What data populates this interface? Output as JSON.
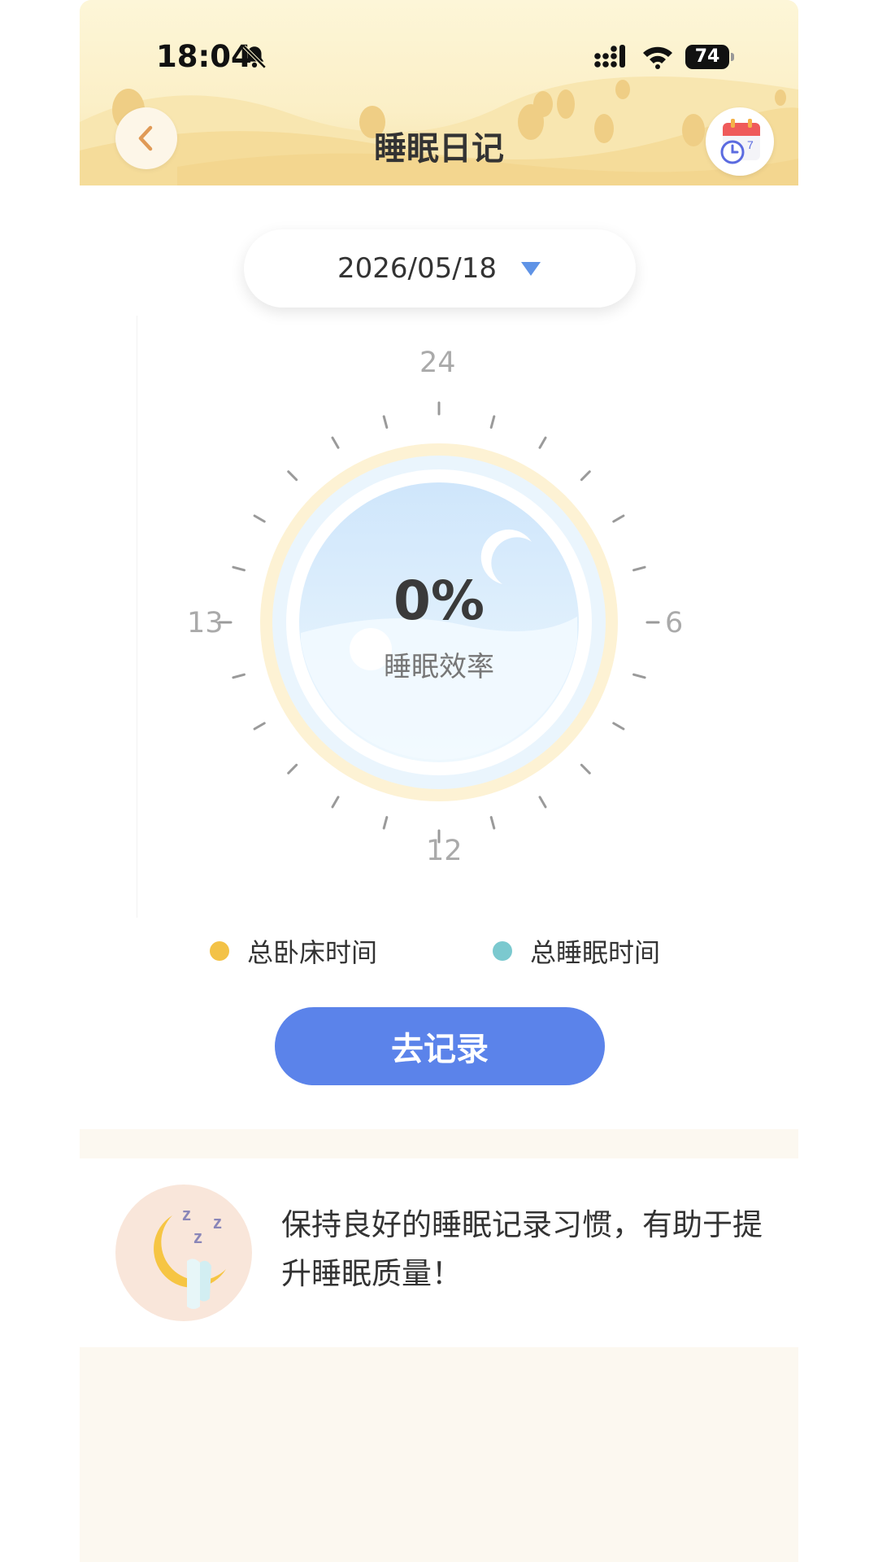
{
  "status_bar": {
    "time": "18:04",
    "battery": "74",
    "icons": [
      "bell-off-icon",
      "signal-icon",
      "wifi-icon",
      "battery-icon"
    ]
  },
  "header": {
    "title": "睡眠日记",
    "back_icon": "chevron-left-icon",
    "calendar_icon": "calendar-clock-icon"
  },
  "date_picker": {
    "value": "2026/05/18",
    "icon": "triangle-down-icon"
  },
  "dial": {
    "hour_labels": {
      "top": "24",
      "right": "6",
      "bottom": "12",
      "left": "13"
    },
    "efficiency_value": "0%",
    "efficiency_label": "睡眠效率",
    "efficiency_fraction": 0
  },
  "legend": {
    "items": [
      {
        "label": "总卧床时间",
        "color": "#f3c247"
      },
      {
        "label": "总睡眠时间",
        "color": "#7bc9cf"
      }
    ]
  },
  "record_button": {
    "label": "去记录"
  },
  "tip": {
    "text": "保持良好的睡眠记录习惯，有助于提升睡眠质量！",
    "icon": "sleeping-moon-icon"
  },
  "colors": {
    "accent": "#5b83ea",
    "header_bg": "#fbefc6",
    "page_bg": "#fcf8f0"
  }
}
